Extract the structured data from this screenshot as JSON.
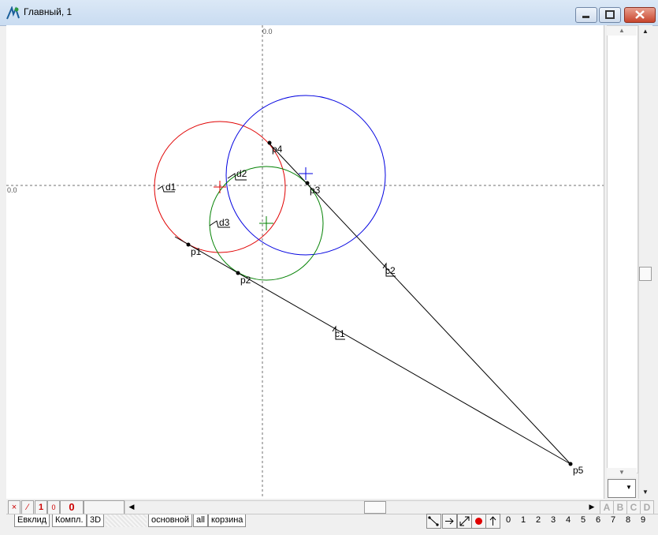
{
  "window": {
    "title": "Главный, 1",
    "buttons": [
      "minimize",
      "maximize",
      "close"
    ]
  },
  "canvas": {
    "axis_label_top": "0.0",
    "axis_label_left": "0.0",
    "point_labels": [
      "p1",
      "p2",
      "p3",
      "p4",
      "p5"
    ],
    "line_labels": [
      "c1",
      "c2"
    ],
    "circle_labels": [
      "d1",
      "d2",
      "d3"
    ],
    "colors": {
      "red_circle": "#e00000",
      "blue_circle": "#0000e0",
      "green_circle": "#008000",
      "lines": "#000000",
      "axes": "#606060"
    }
  },
  "bottom_toolbar": {
    "status_buttons": [
      "×",
      "⁄",
      "1",
      "0"
    ],
    "counter": "0",
    "letters": [
      "A",
      "B",
      "C",
      "D"
    ]
  },
  "tabs": {
    "left": [
      "Евклид",
      "Компл.",
      "3D"
    ],
    "right": [
      "основной",
      "all",
      "корзина"
    ]
  },
  "tool_buttons": [
    "connect-tool",
    "arrow-right-tool",
    "resize-tool",
    "record-tool",
    "up-arrow-tool"
  ],
  "digits": [
    "0",
    "1",
    "2",
    "3",
    "4",
    "5",
    "6",
    "7",
    "8",
    "9"
  ]
}
